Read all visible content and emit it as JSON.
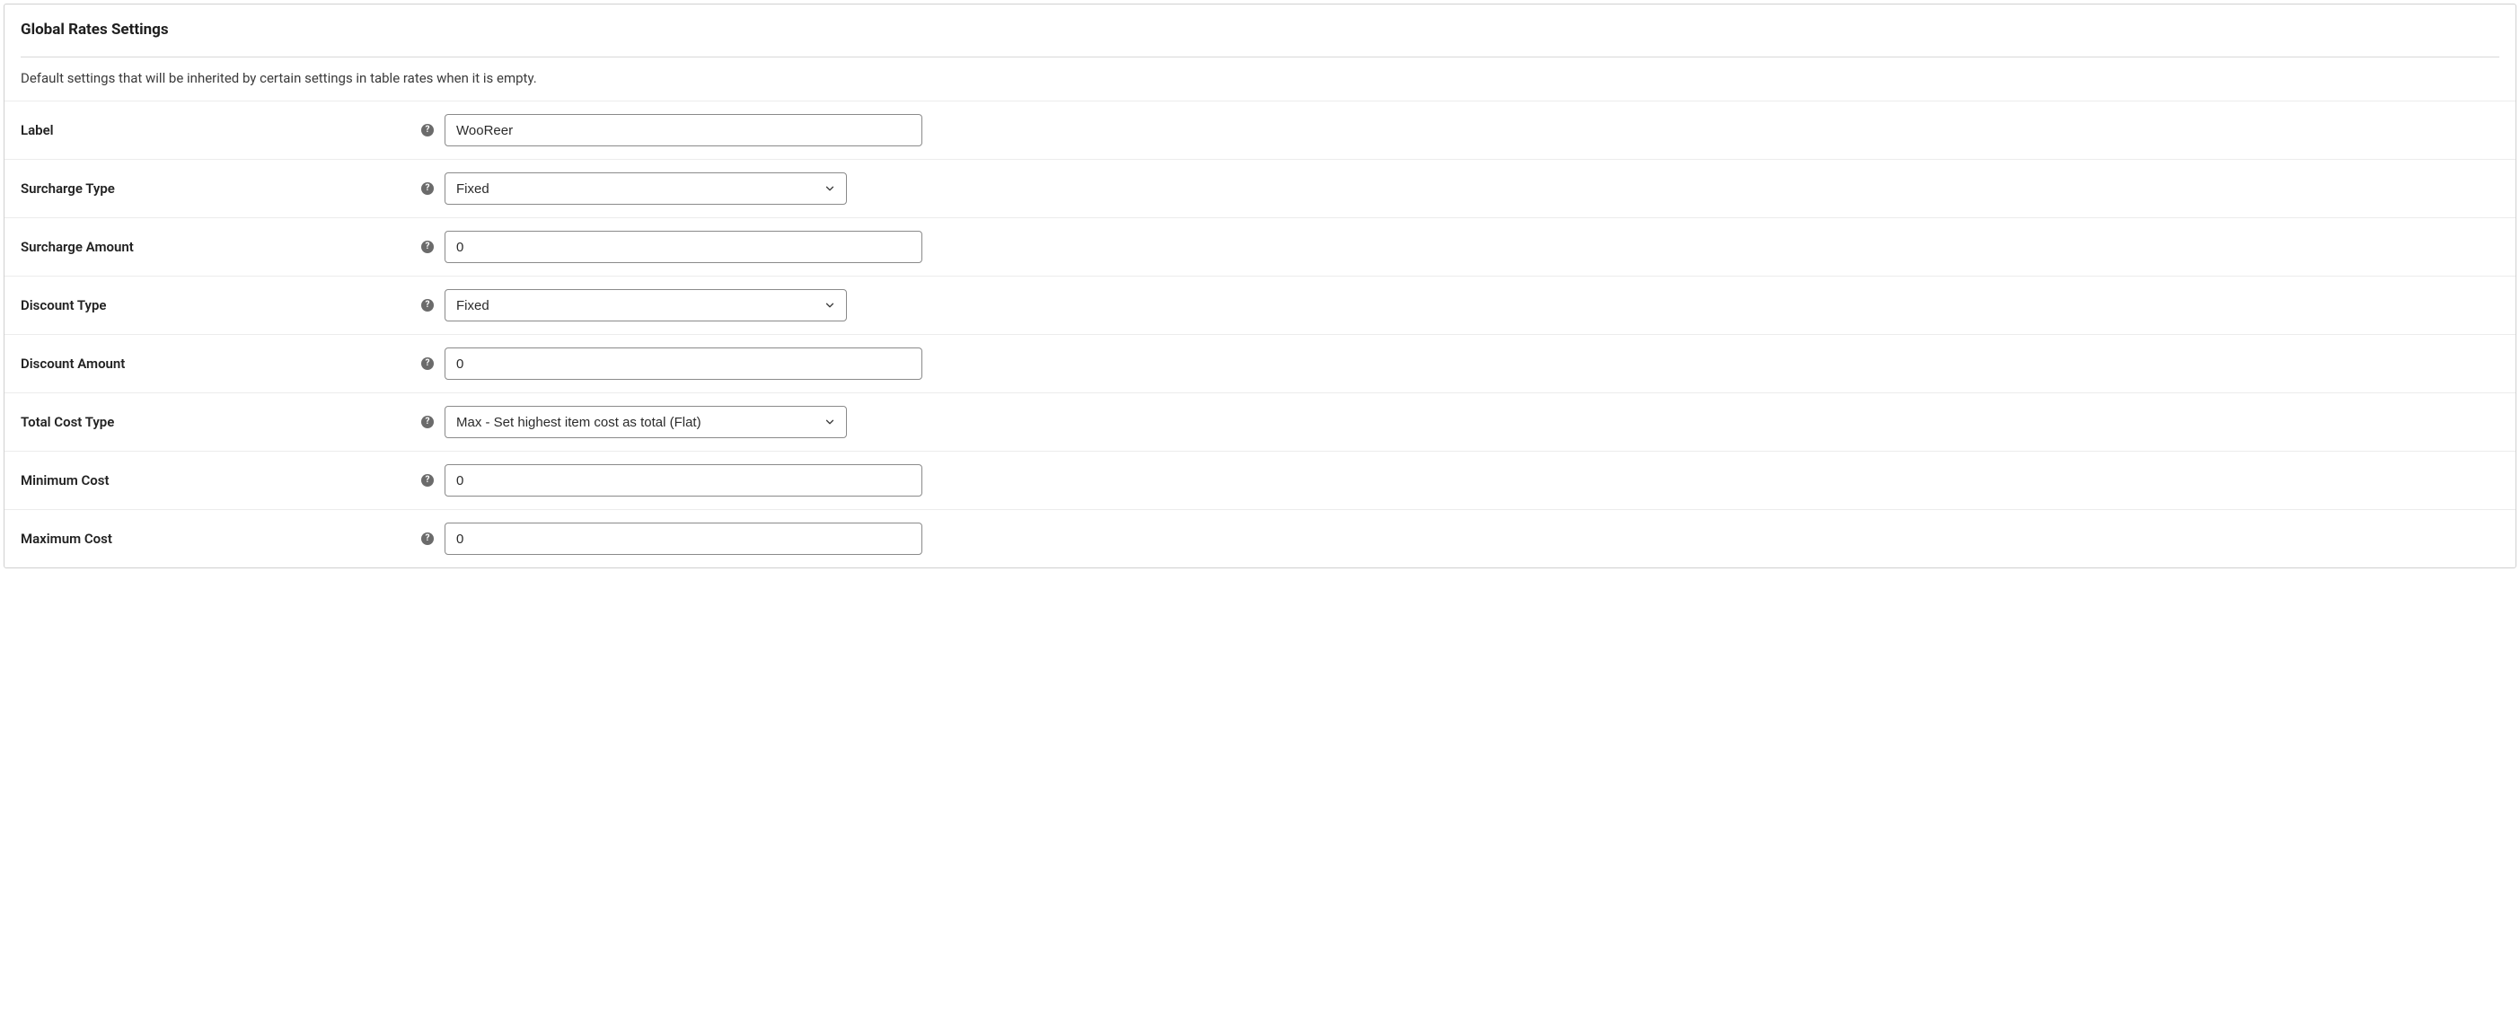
{
  "section": {
    "title": "Global Rates Settings",
    "description": "Default settings that will be inherited by certain settings in table rates when it is empty."
  },
  "help_glyph": "?",
  "fields": {
    "label": {
      "label": "Label",
      "value": "WooReer"
    },
    "surcharge_type": {
      "label": "Surcharge Type",
      "value": "Fixed"
    },
    "surcharge_amount": {
      "label": "Surcharge Amount",
      "value": "0"
    },
    "discount_type": {
      "label": "Discount Type",
      "value": "Fixed"
    },
    "discount_amount": {
      "label": "Discount Amount",
      "value": "0"
    },
    "total_cost_type": {
      "label": "Total Cost Type",
      "value": "Max - Set highest item cost as total (Flat)"
    },
    "minimum_cost": {
      "label": "Minimum Cost",
      "value": "0"
    },
    "maximum_cost": {
      "label": "Maximum Cost",
      "value": "0"
    }
  }
}
